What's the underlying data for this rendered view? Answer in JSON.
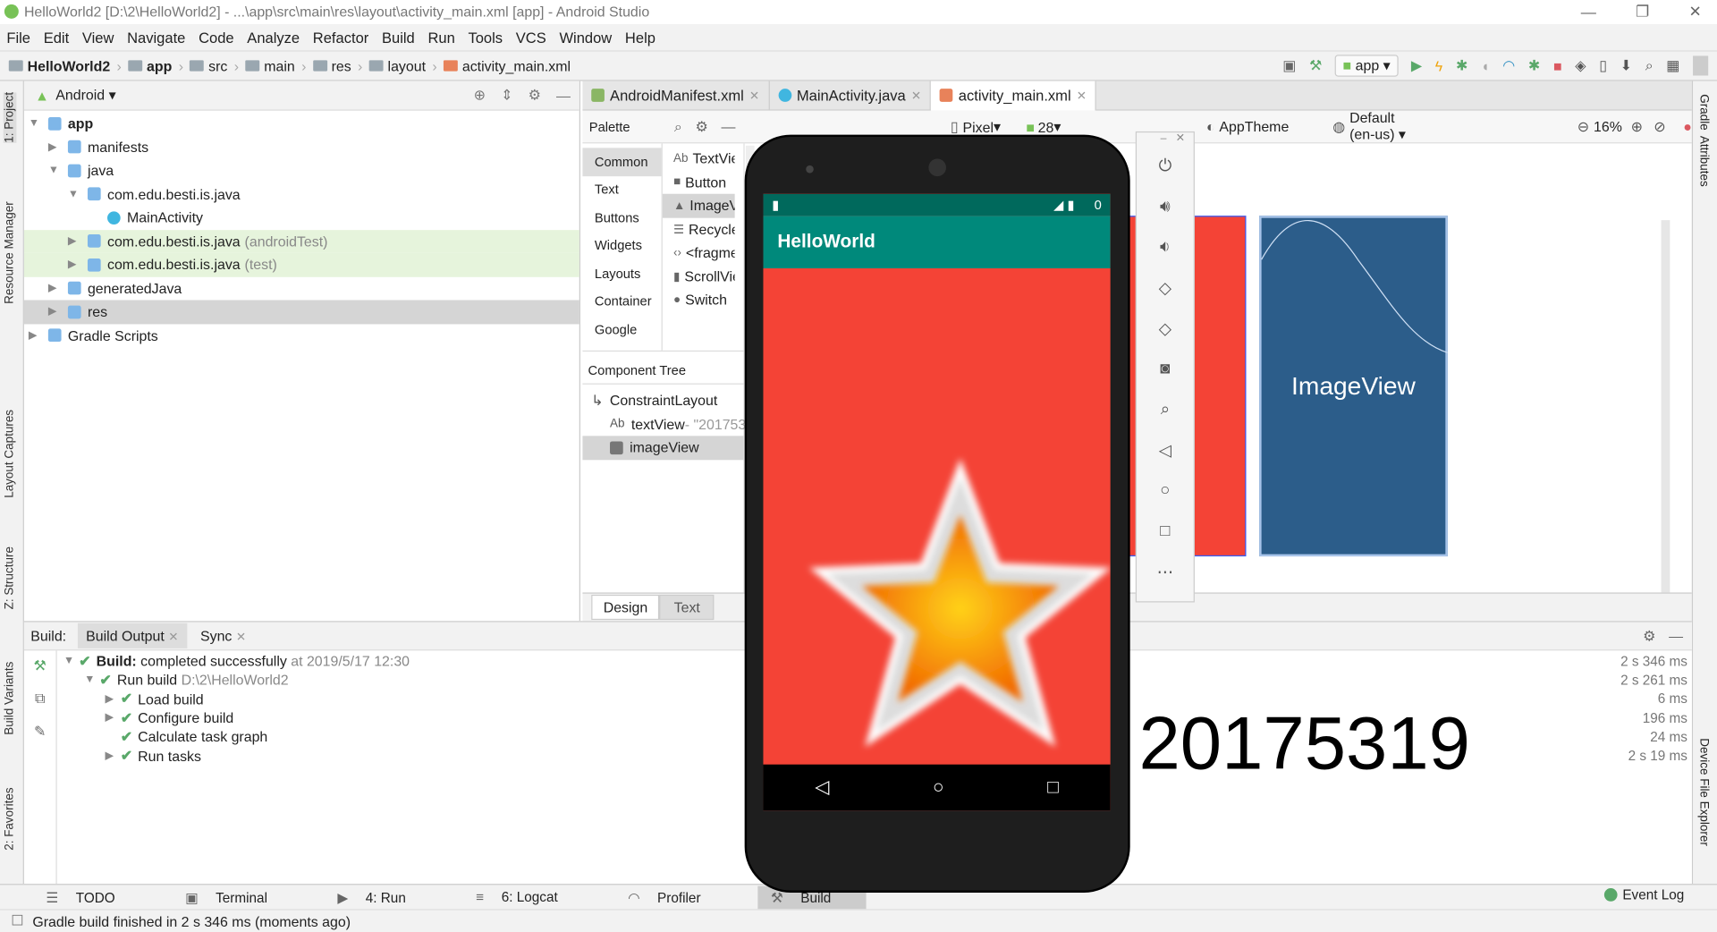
{
  "window": {
    "title": "HelloWorld2 [D:\\2\\HelloWorld2] - ...\\app\\src\\main\\res\\layout\\activity_main.xml [app] - Android Studio"
  },
  "menu": [
    "File",
    "Edit",
    "View",
    "Navigate",
    "Code",
    "Analyze",
    "Refactor",
    "Build",
    "Run",
    "Tools",
    "VCS",
    "Window",
    "Help"
  ],
  "breadcrumb": [
    "HelloWorld2",
    "app",
    "src",
    "main",
    "res",
    "layout",
    "activity_main.xml"
  ],
  "toolbar": {
    "run_config": "app"
  },
  "project": {
    "view": "Android",
    "tree": [
      {
        "label": "app",
        "depth": 0,
        "bold": true,
        "open": true
      },
      {
        "label": "manifests",
        "depth": 1
      },
      {
        "label": "java",
        "depth": 1,
        "open": true
      },
      {
        "label": "com.edu.besti.is.java",
        "depth": 2,
        "open": true
      },
      {
        "label": "MainActivity",
        "depth": 3,
        "leaf": true
      },
      {
        "label": "com.edu.besti.is.java",
        "suffix": "(androidTest)",
        "depth": 2,
        "highlight": true
      },
      {
        "label": "com.edu.besti.is.java",
        "suffix": "(test)",
        "depth": 2,
        "highlight": true
      },
      {
        "label": "generatedJava",
        "depth": 1
      },
      {
        "label": "res",
        "depth": 1,
        "selected": true
      },
      {
        "label": "Gradle Scripts",
        "depth": 0
      }
    ]
  },
  "editor_tabs": [
    "AndroidManifest.xml",
    "MainActivity.java",
    "activity_main.xml"
  ],
  "design_toolbar": {
    "device": "Pixel",
    "api": "28",
    "theme": "AppTheme",
    "locale": "Default (en-us)",
    "zoom": "16%"
  },
  "palette": {
    "title": "Palette",
    "categories": [
      "Common",
      "Text",
      "Buttons",
      "Widgets",
      "Layouts",
      "Container",
      "Google"
    ],
    "items": [
      "TextView",
      "Button",
      "ImageView",
      "RecyclerView",
      "<fragment>",
      "ScrollView",
      "Switch"
    ]
  },
  "component_tree": {
    "title": "Component Tree",
    "items": [
      "ConstraintLayout",
      "textView",
      "imageView"
    ],
    "textview_hint": "- \"20175319\""
  },
  "blueprint": {
    "label": "ImageView"
  },
  "design_tabs": [
    "Design",
    "Text"
  ],
  "emulator": {
    "app_title": "HelloWorld",
    "status_right": "0",
    "text": "20175319"
  },
  "left_tools": [
    "1: Project",
    "Resource Manager",
    "Layout Captures",
    "Z: Structure",
    "Build Variants",
    "2: Favorites"
  ],
  "right_tools": [
    "Gradle",
    "Attributes",
    "Device File Explorer"
  ],
  "build": {
    "label": "Build:",
    "tabs": [
      "Build Output",
      "Sync"
    ],
    "lines": [
      {
        "bold": "Build:",
        "text": " completed successfully",
        "muted": " at 2019/5/17 12:30",
        "depth": 0,
        "arrow": "down",
        "time": "2 s 346 ms"
      },
      {
        "text": "Run build ",
        "muted": "D:\\2\\HelloWorld2",
        "depth": 1,
        "arrow": "down",
        "time": "2 s 261 ms"
      },
      {
        "text": "Load build",
        "depth": 2,
        "arrow": "right",
        "time": "6 ms"
      },
      {
        "text": "Configure build",
        "depth": 2,
        "arrow": "right",
        "time": "196 ms"
      },
      {
        "text": "Calculate task graph",
        "depth": 2,
        "arrow": "",
        "time": "24 ms"
      },
      {
        "text": "Run tasks",
        "depth": 2,
        "arrow": "right",
        "time": "2 s 19 ms"
      }
    ]
  },
  "bottom_tools": [
    "TODO",
    "Terminal",
    "4: Run",
    "6: Logcat",
    "Profiler",
    "Build"
  ],
  "event_log": "Event Log",
  "status": "Gradle build finished in 2 s 346 ms (moments ago)",
  "colors": {
    "accent": "#00897b",
    "status_bar": "#00695c",
    "screen": "#f44336",
    "imageview": "#2c5d8a",
    "check": "#59a869"
  }
}
